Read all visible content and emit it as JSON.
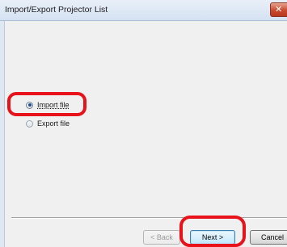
{
  "window": {
    "title": "Import/Export Projector List",
    "close_glyph": "✕"
  },
  "options": [
    {
      "label": "Import file",
      "selected": true
    },
    {
      "label": "Export file",
      "selected": false
    }
  ],
  "buttons": {
    "back_label": "< Back",
    "next_label": "Next >",
    "cancel_label": "Cancel"
  },
  "colors": {
    "highlight": "#e8121b"
  }
}
